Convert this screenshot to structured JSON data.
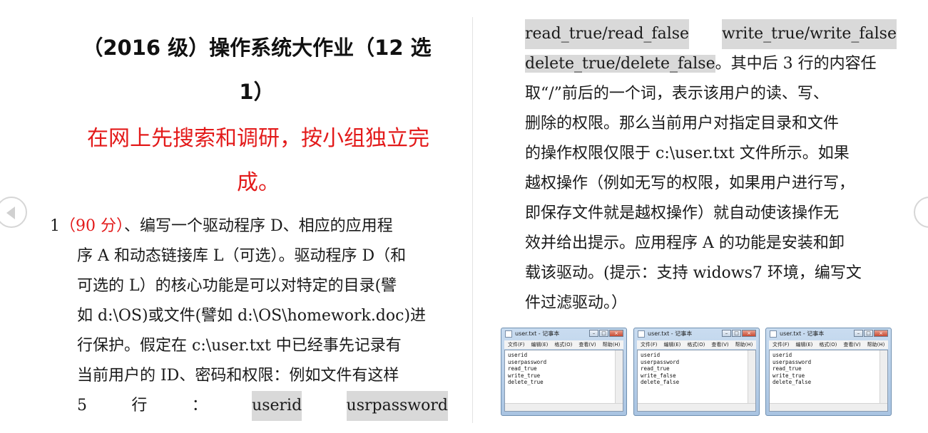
{
  "doc": {
    "title": [
      "（2016 级）操作系统大作业（12 选",
      "1）"
    ],
    "subtitle": [
      "在网上先搜索和调研，按小组独立完",
      "成。"
    ],
    "left_lines": [
      {
        "parts": [
          [
            "1",
            ""
          ],
          [
            "（90 分）",
            "red"
          ],
          [
            "、编写一个驱动程序 D、相应的应用程",
            ""
          ]
        ]
      },
      {
        "parts": [
          [
            "序 A 和动态链接库 L（可选）。驱动程序 D（和",
            ""
          ]
        ]
      },
      {
        "parts": [
          [
            "可选的 L）的核心功能是可以对特定的目录(譬",
            ""
          ]
        ]
      },
      {
        "parts": [
          [
            "如 d:\\OS)或文件(譬如 d:\\OS\\homework.doc)进",
            ""
          ]
        ]
      },
      {
        "parts": [
          [
            "行保护。假定在 c:\\user.txt 中已经事先记录有",
            ""
          ]
        ]
      },
      {
        "parts": [
          [
            "当前用户的 ID、密码和权限：例如文件有这样",
            ""
          ]
        ]
      },
      {
        "parts": [
          [
            "5",
            ""
          ],
          [
            "行",
            ""
          ],
          [
            "：",
            ""
          ],
          [
            "userid",
            "hl"
          ],
          [
            "usrpassword",
            "hl"
          ]
        ],
        "justify": true
      }
    ],
    "right_lines": [
      {
        "parts": [
          [
            "read_true/read_false",
            "hl"
          ],
          [
            "write_true/write_false",
            "hl"
          ]
        ],
        "justify": true
      },
      {
        "parts": [
          [
            "delete_true/delete_false",
            "hl"
          ],
          [
            "。其中后 3 行的内容任",
            ""
          ]
        ]
      },
      {
        "parts": [
          [
            "取“/”前后的一个词，表示该用户的读、写、",
            ""
          ]
        ]
      },
      {
        "parts": [
          [
            "删除的权限。那么当前用户对指定目录和文件",
            ""
          ]
        ]
      },
      {
        "parts": [
          [
            "的操作权限仅限于 c:\\user.txt 文件所示。如果",
            ""
          ]
        ]
      },
      {
        "parts": [
          [
            "越权操作（例如无写的权限，如果用户进行写，",
            ""
          ]
        ]
      },
      {
        "parts": [
          [
            "即保存文件就是越权操作）就自动使该操作无",
            ""
          ]
        ]
      },
      {
        "parts": [
          [
            "效并给出提示。应用程序 A 的功能是安装和卸",
            ""
          ]
        ]
      },
      {
        "parts": [
          [
            "载该驱动。(提示：支持 widows7 环境，编写文",
            ""
          ]
        ]
      },
      {
        "parts": [
          [
            "件过滤驱动。）",
            ""
          ]
        ]
      }
    ]
  },
  "screenshots": [
    {
      "title": "user.txt - 记事本",
      "menu": [
        "文件(F)",
        "编辑(E)",
        "格式(O)",
        "查看(V)",
        "帮助(H)"
      ],
      "lines": [
        "userid",
        "userpassword",
        "read_true",
        "write_true",
        "delete_true"
      ]
    },
    {
      "title": "user.txt - 记事本",
      "menu": [
        "文件(F)",
        "编辑(E)",
        "格式(O)",
        "查看(V)",
        "帮助(H)"
      ],
      "lines": [
        "userid",
        "userpassword",
        "read_true",
        "write_false",
        "delete_false"
      ]
    },
    {
      "title": "user.txt - 记事本",
      "menu": [
        "文件(F)",
        "编辑(E)",
        "格式(O)",
        "查看(V)",
        "帮助(H)"
      ],
      "lines": [
        "userid",
        "userpassword",
        "read_true",
        "write_true",
        "delete_false"
      ]
    }
  ],
  "window_buttons": {
    "minimize": "–",
    "maximize": "□",
    "close": "×"
  }
}
